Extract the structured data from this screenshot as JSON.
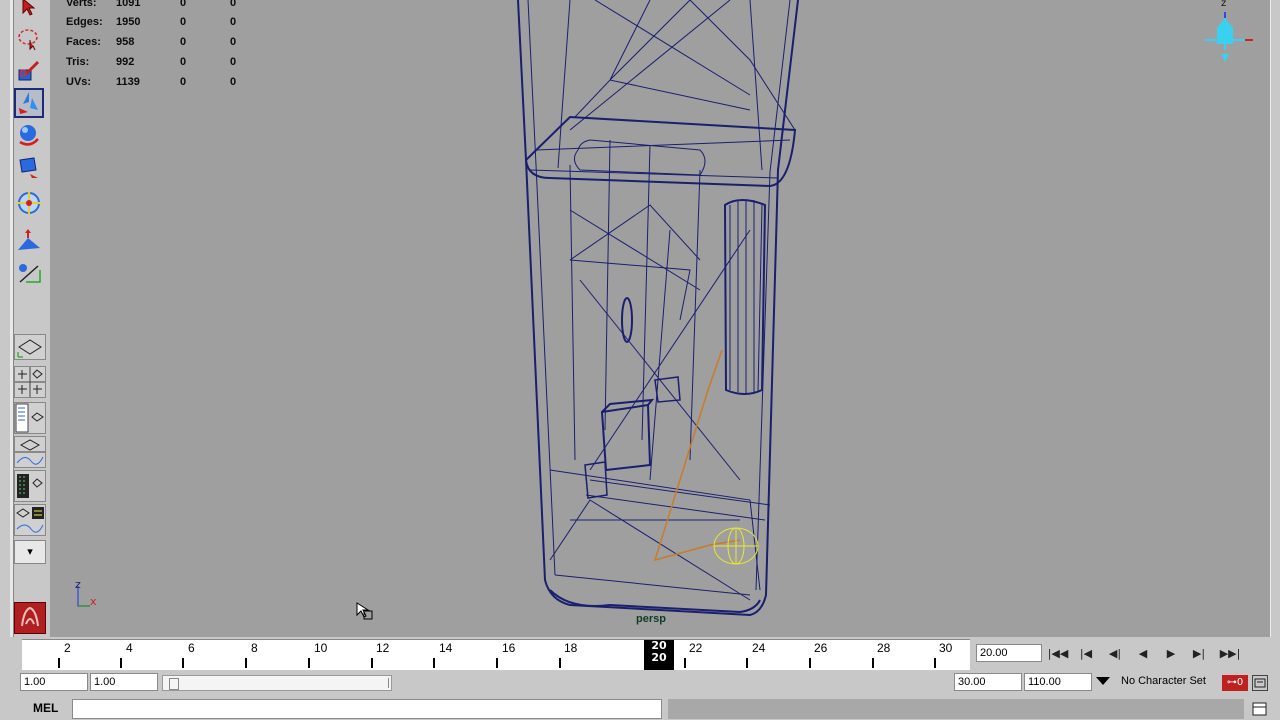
{
  "hud": {
    "rows": [
      {
        "label": "Verts:",
        "v1": "1091",
        "v2": "0",
        "v3": "0"
      },
      {
        "label": "Edges:",
        "v1": "1950",
        "v2": "0",
        "v3": "0"
      },
      {
        "label": "Faces:",
        "v1": "958",
        "v2": "0",
        "v3": "0"
      },
      {
        "label": "Tris:",
        "v1": "992",
        "v2": "0",
        "v3": "0"
      },
      {
        "label": "UVs:",
        "v1": "1139",
        "v2": "0",
        "v3": "0"
      }
    ]
  },
  "viewport": {
    "camera": "persp",
    "axis_z": "z",
    "axis_x": "x",
    "cube_z": "z",
    "colors": {
      "background": "#9f9f9f",
      "wireframe": "#1a1f6e",
      "joint": "#c87c2a",
      "locator": "#e8e832"
    }
  },
  "toolbox": {
    "tools": [
      "select-tool-icon",
      "lasso-tool-icon",
      "paint-select-icon",
      "move-tool-icon",
      "rotate-tool-icon",
      "scale-tool-icon",
      "universal-manipulator-icon",
      "soft-modification-icon",
      "show-manipulator-icon"
    ],
    "layouts": [
      "single-perspective-layout-icon",
      "four-view-layout-icon",
      "outliner-persp-layout-icon",
      "persp-graph-layout-icon",
      "hypershade-layout-icon",
      "persp-graph-outliner-layout-icon"
    ],
    "menu_arrow": "▾"
  },
  "timeline": {
    "tick_labels": [
      "2",
      "4",
      "6",
      "8",
      "10",
      "12",
      "14",
      "16",
      "18",
      "20",
      "22",
      "24",
      "26",
      "28",
      "30"
    ],
    "current_frame": "20",
    "current_frame_field": "20.00"
  },
  "playback": {
    "buttons": [
      "goto-start-icon",
      "step-back-key-icon",
      "step-back-frame-icon",
      "play-backward-icon",
      "play-forward-icon",
      "step-forward-frame-icon",
      "goto-end-icon"
    ],
    "glyphs": [
      "|◀◀",
      "|◀",
      "◀|",
      "◀",
      "▶",
      "▶|",
      "▶▶|"
    ]
  },
  "range": {
    "start": "1.00",
    "start_inner": "1.00",
    "end_inner": "30.00",
    "end": "110.00",
    "character_set": "No Character Set"
  },
  "command_line": {
    "label": "MEL",
    "value": ""
  }
}
